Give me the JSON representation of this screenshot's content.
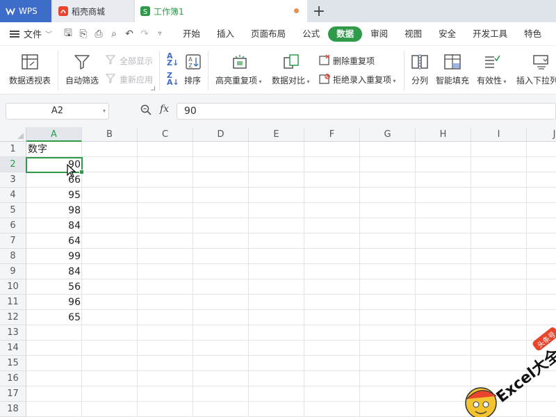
{
  "tabs": [
    {
      "label": "WPS"
    },
    {
      "label": "稻壳商城"
    },
    {
      "label": "工作簿1"
    }
  ],
  "menubar": {
    "file_label": "文件",
    "items": [
      "开始",
      "插入",
      "页面布局",
      "公式",
      "数据",
      "审阅",
      "视图",
      "安全",
      "开发工具",
      "特色"
    ],
    "active": "数据"
  },
  "ribbon": {
    "pivot": "数据透视表",
    "autofilter": "自动筛选",
    "show_all": "全部显示",
    "reapply": "重新应用",
    "sort": "排序",
    "highlight_dup": "高亮重复项",
    "compare": "数据对比",
    "remove_dup": "删除重复项",
    "reject_dup": "拒绝录入重复项",
    "split": "分列",
    "smart_fill": "智能填充",
    "validity": "有效性",
    "insert_dropdown": "插入下拉列表"
  },
  "formula_bar": {
    "name_box": "A2",
    "fx": "fx",
    "value": "90"
  },
  "grid": {
    "columns": [
      "A",
      "B",
      "C",
      "D",
      "E",
      "F",
      "G",
      "H",
      "I",
      "J"
    ],
    "selected_column": "A",
    "rows": [
      "1",
      "2",
      "3",
      "4",
      "5",
      "6",
      "7",
      "8",
      "9",
      "10",
      "11",
      "12",
      "13",
      "14",
      "15",
      "16",
      "17",
      "18"
    ],
    "selected_row": "2",
    "header_cell": "数字",
    "values": [
      "90",
      "66",
      "95",
      "98",
      "84",
      "64",
      "99",
      "84",
      "56",
      "96",
      "65"
    ]
  },
  "watermark": {
    "text": "Excel大全",
    "badge": "头条号"
  }
}
